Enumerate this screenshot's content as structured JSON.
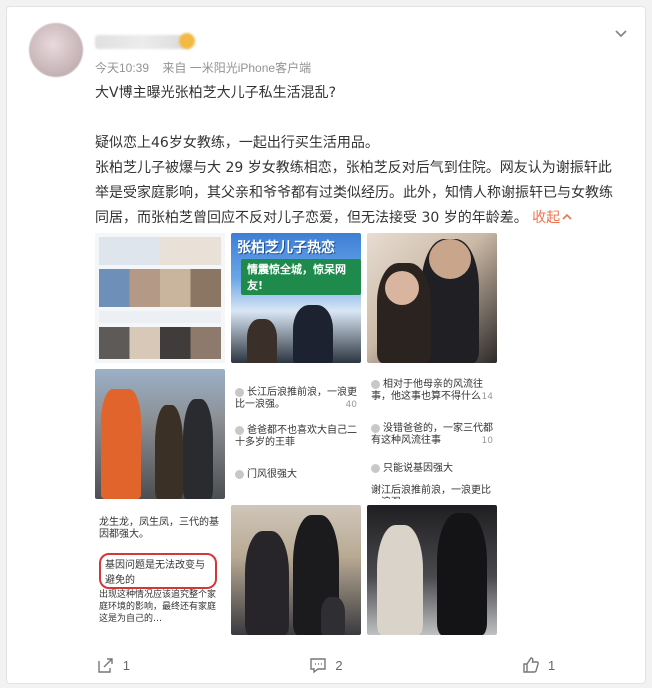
{
  "post": {
    "time": "今天10:39",
    "source": "来自 一米阳光iPhone客户端",
    "title": "大V博主曝光张柏芝大儿子私生活混乱?",
    "para1": "疑似恋上46岁女教练，一起出行买生活用品。",
    "para2": "张柏芝儿子被爆与大 29 岁女教练相恋，张柏芝反对后气到住院。网友认为谢振轩此举是受家庭影响，其父亲和爷爷都有过类似经历。此外，知情人称谢振轩已与女教练同居，而张柏芝曾回应不反对儿子恋爱，但无法接受 30 岁的年龄差。",
    "collapse": "收起",
    "collapse_icon": "chevron-up-icon"
  },
  "images": {
    "tile2_title": "张柏芝儿子热恋",
    "tile2_banner": "情震惊全城，惊呆网友!",
    "tile5_comments": [
      {
        "text": "长江后浪推前浪，一浪更比一浪强。",
        "likes": "40"
      },
      {
        "text": "爸爸都不也喜欢大自己二十多岁的王菲",
        "likes": ""
      },
      {
        "text": "门风很强大",
        "likes": ""
      }
    ],
    "tile6_comments": [
      {
        "text": "相对于他母亲的风流往事，他这事也算不得什么",
        "likes": "14"
      },
      {
        "text": "没错爸爸的，一家三代都有这种风流往事",
        "likes": "10"
      },
      {
        "text": "只能说基因强大",
        "likes": ""
      },
      {
        "text": "谢江后浪推前浪，一浪更比一浪强。",
        "likes": ""
      }
    ],
    "tile7_comments": [
      {
        "text": "龙生龙，凤生凤，三代的基因都强大。",
        "highlight": false
      },
      {
        "text": "基因问题是无法改变与避免的",
        "highlight": true
      },
      {
        "text": "出现这种情况应该追究整个家庭环境的影响，最终还有家庭这是为自己的…",
        "highlight": false
      }
    ]
  },
  "actions": {
    "share_count": "1",
    "comment_count": "2",
    "like_count": "1"
  }
}
